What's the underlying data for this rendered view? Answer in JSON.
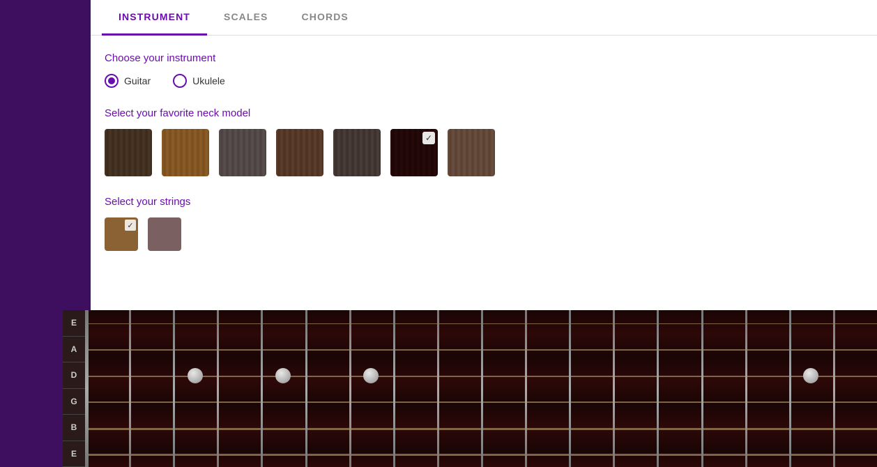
{
  "tabs": [
    {
      "id": "instrument",
      "label": "INSTRUMENT",
      "active": true
    },
    {
      "id": "scales",
      "label": "SCALES",
      "active": false
    },
    {
      "id": "chords",
      "label": "CHORDS",
      "active": false
    }
  ],
  "instrument_section": {
    "choose_label": "Choose your instrument",
    "guitar_label": "Guitar",
    "ukulele_label": "Ukulele",
    "guitar_selected": true,
    "neck_label": "Select your favorite neck model",
    "strings_label": "Select your strings"
  },
  "neck_swatches": [
    {
      "id": "neck1",
      "color": "#4a3728",
      "selected": false
    },
    {
      "id": "neck2",
      "color": "#8b5e2a",
      "selected": false
    },
    {
      "id": "neck3",
      "color": "#5a5050",
      "selected": false
    },
    {
      "id": "neck4",
      "color": "#5e4030",
      "selected": false
    },
    {
      "id": "neck5",
      "color": "#4a3f3a",
      "selected": false
    },
    {
      "id": "neck6",
      "color": "#2a0a0a",
      "selected": true
    },
    {
      "id": "neck7",
      "color": "#6a5040",
      "selected": false
    }
  ],
  "string_swatches": [
    {
      "id": "str1",
      "color": "#8b6234",
      "selected": true
    },
    {
      "id": "str2",
      "color": "#7a6060",
      "selected": false
    }
  ],
  "fretboard": {
    "strings": [
      "E",
      "A",
      "D",
      "G",
      "B",
      "E"
    ],
    "fret_count": 18,
    "dots": [
      {
        "fret": 3,
        "string": 2,
        "label": ""
      },
      {
        "fret": 5,
        "string": 2,
        "label": ""
      },
      {
        "fret": 7,
        "string": 2,
        "label": ""
      },
      {
        "fret": 17,
        "string": 2,
        "label": ""
      }
    ]
  }
}
